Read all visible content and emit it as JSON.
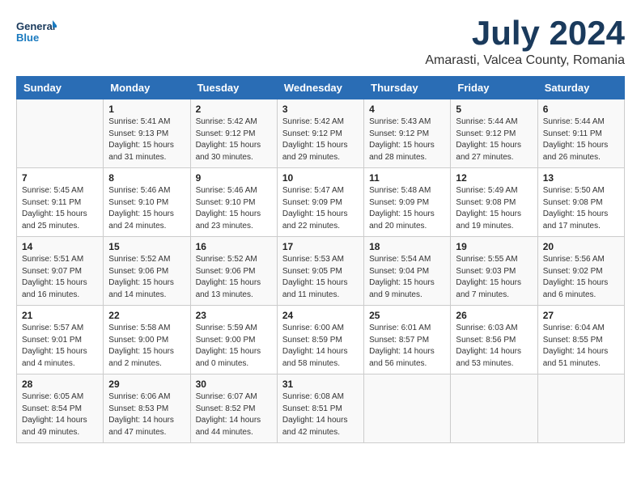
{
  "header": {
    "logo_line1": "General",
    "logo_line2": "Blue",
    "month": "July 2024",
    "location": "Amarasti, Valcea County, Romania"
  },
  "days_of_week": [
    "Sunday",
    "Monday",
    "Tuesday",
    "Wednesday",
    "Thursday",
    "Friday",
    "Saturday"
  ],
  "weeks": [
    [
      {
        "day": "",
        "info": ""
      },
      {
        "day": "1",
        "info": "Sunrise: 5:41 AM\nSunset: 9:13 PM\nDaylight: 15 hours\nand 31 minutes."
      },
      {
        "day": "2",
        "info": "Sunrise: 5:42 AM\nSunset: 9:12 PM\nDaylight: 15 hours\nand 30 minutes."
      },
      {
        "day": "3",
        "info": "Sunrise: 5:42 AM\nSunset: 9:12 PM\nDaylight: 15 hours\nand 29 minutes."
      },
      {
        "day": "4",
        "info": "Sunrise: 5:43 AM\nSunset: 9:12 PM\nDaylight: 15 hours\nand 28 minutes."
      },
      {
        "day": "5",
        "info": "Sunrise: 5:44 AM\nSunset: 9:12 PM\nDaylight: 15 hours\nand 27 minutes."
      },
      {
        "day": "6",
        "info": "Sunrise: 5:44 AM\nSunset: 9:11 PM\nDaylight: 15 hours\nand 26 minutes."
      }
    ],
    [
      {
        "day": "7",
        "info": "Sunrise: 5:45 AM\nSunset: 9:11 PM\nDaylight: 15 hours\nand 25 minutes."
      },
      {
        "day": "8",
        "info": "Sunrise: 5:46 AM\nSunset: 9:10 PM\nDaylight: 15 hours\nand 24 minutes."
      },
      {
        "day": "9",
        "info": "Sunrise: 5:46 AM\nSunset: 9:10 PM\nDaylight: 15 hours\nand 23 minutes."
      },
      {
        "day": "10",
        "info": "Sunrise: 5:47 AM\nSunset: 9:09 PM\nDaylight: 15 hours\nand 22 minutes."
      },
      {
        "day": "11",
        "info": "Sunrise: 5:48 AM\nSunset: 9:09 PM\nDaylight: 15 hours\nand 20 minutes."
      },
      {
        "day": "12",
        "info": "Sunrise: 5:49 AM\nSunset: 9:08 PM\nDaylight: 15 hours\nand 19 minutes."
      },
      {
        "day": "13",
        "info": "Sunrise: 5:50 AM\nSunset: 9:08 PM\nDaylight: 15 hours\nand 17 minutes."
      }
    ],
    [
      {
        "day": "14",
        "info": "Sunrise: 5:51 AM\nSunset: 9:07 PM\nDaylight: 15 hours\nand 16 minutes."
      },
      {
        "day": "15",
        "info": "Sunrise: 5:52 AM\nSunset: 9:06 PM\nDaylight: 15 hours\nand 14 minutes."
      },
      {
        "day": "16",
        "info": "Sunrise: 5:52 AM\nSunset: 9:06 PM\nDaylight: 15 hours\nand 13 minutes."
      },
      {
        "day": "17",
        "info": "Sunrise: 5:53 AM\nSunset: 9:05 PM\nDaylight: 15 hours\nand 11 minutes."
      },
      {
        "day": "18",
        "info": "Sunrise: 5:54 AM\nSunset: 9:04 PM\nDaylight: 15 hours\nand 9 minutes."
      },
      {
        "day": "19",
        "info": "Sunrise: 5:55 AM\nSunset: 9:03 PM\nDaylight: 15 hours\nand 7 minutes."
      },
      {
        "day": "20",
        "info": "Sunrise: 5:56 AM\nSunset: 9:02 PM\nDaylight: 15 hours\nand 6 minutes."
      }
    ],
    [
      {
        "day": "21",
        "info": "Sunrise: 5:57 AM\nSunset: 9:01 PM\nDaylight: 15 hours\nand 4 minutes."
      },
      {
        "day": "22",
        "info": "Sunrise: 5:58 AM\nSunset: 9:00 PM\nDaylight: 15 hours\nand 2 minutes."
      },
      {
        "day": "23",
        "info": "Sunrise: 5:59 AM\nSunset: 9:00 PM\nDaylight: 15 hours\nand 0 minutes."
      },
      {
        "day": "24",
        "info": "Sunrise: 6:00 AM\nSunset: 8:59 PM\nDaylight: 14 hours\nand 58 minutes."
      },
      {
        "day": "25",
        "info": "Sunrise: 6:01 AM\nSunset: 8:57 PM\nDaylight: 14 hours\nand 56 minutes."
      },
      {
        "day": "26",
        "info": "Sunrise: 6:03 AM\nSunset: 8:56 PM\nDaylight: 14 hours\nand 53 minutes."
      },
      {
        "day": "27",
        "info": "Sunrise: 6:04 AM\nSunset: 8:55 PM\nDaylight: 14 hours\nand 51 minutes."
      }
    ],
    [
      {
        "day": "28",
        "info": "Sunrise: 6:05 AM\nSunset: 8:54 PM\nDaylight: 14 hours\nand 49 minutes."
      },
      {
        "day": "29",
        "info": "Sunrise: 6:06 AM\nSunset: 8:53 PM\nDaylight: 14 hours\nand 47 minutes."
      },
      {
        "day": "30",
        "info": "Sunrise: 6:07 AM\nSunset: 8:52 PM\nDaylight: 14 hours\nand 44 minutes."
      },
      {
        "day": "31",
        "info": "Sunrise: 6:08 AM\nSunset: 8:51 PM\nDaylight: 14 hours\nand 42 minutes."
      },
      {
        "day": "",
        "info": ""
      },
      {
        "day": "",
        "info": ""
      },
      {
        "day": "",
        "info": ""
      }
    ]
  ]
}
